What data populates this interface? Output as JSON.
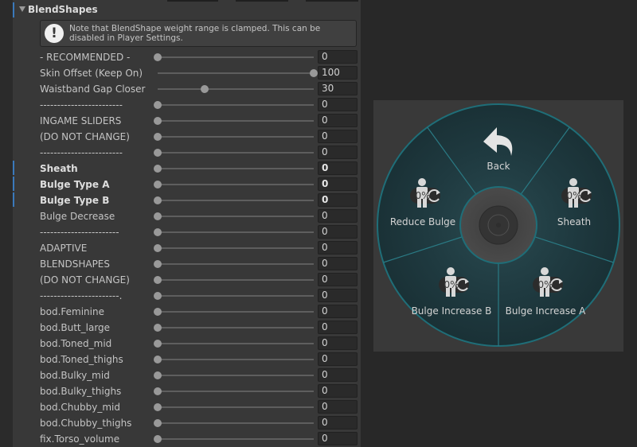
{
  "inspector": {
    "section_title": "BlendShapes",
    "help_text": "Note that BlendShape weight range is clamped. This can be disabled in Player Settings.",
    "help_icon": "exclamation-icon",
    "slider_max": 100,
    "rows": [
      {
        "label": "- RECOMMENDED -",
        "value": 0,
        "bold": false,
        "highlight": false
      },
      {
        "label": "Skin Offset (Keep On)",
        "value": 100,
        "bold": false,
        "highlight": false
      },
      {
        "label": "Waistband Gap Closer",
        "value": 30,
        "bold": false,
        "highlight": false
      },
      {
        "label": "------------------------",
        "value": 0,
        "bold": false,
        "highlight": false
      },
      {
        "label": "INGAME SLIDERS",
        "value": 0,
        "bold": false,
        "highlight": false
      },
      {
        "label": "(DO NOT CHANGE)",
        "value": 0,
        "bold": false,
        "highlight": false
      },
      {
        "label": "------------------------",
        "value": 0,
        "bold": false,
        "highlight": false
      },
      {
        "label": "Sheath",
        "value": 0,
        "bold": true,
        "highlight": true
      },
      {
        "label": "Bulge Type A",
        "value": 0,
        "bold": true,
        "highlight": true
      },
      {
        "label": "Bulge Type B",
        "value": 0,
        "bold": true,
        "highlight": true
      },
      {
        "label": "Bulge Decrease",
        "value": 0,
        "bold": false,
        "highlight": false
      },
      {
        "label": "-----------------------",
        "value": 0,
        "bold": false,
        "highlight": false
      },
      {
        "label": "ADAPTIVE",
        "value": 0,
        "bold": false,
        "highlight": false
      },
      {
        "label": "BLENDSHAPES",
        "value": 0,
        "bold": false,
        "highlight": false
      },
      {
        "label": "(DO NOT CHANGE)",
        "value": 0,
        "bold": false,
        "highlight": false
      },
      {
        "label": "-----------------------.",
        "value": 0,
        "bold": false,
        "highlight": false
      },
      {
        "label": "bod.Feminine",
        "value": 0,
        "bold": false,
        "highlight": false
      },
      {
        "label": "bod.Butt_large",
        "value": 0,
        "bold": false,
        "highlight": false
      },
      {
        "label": "bod.Toned_mid",
        "value": 0,
        "bold": false,
        "highlight": false
      },
      {
        "label": "bod.Toned_thighs",
        "value": 0,
        "bold": false,
        "highlight": false
      },
      {
        "label": "bod.Bulky_mid",
        "value": 0,
        "bold": false,
        "highlight": false
      },
      {
        "label": "bod.Bulky_thighs",
        "value": 0,
        "bold": false,
        "highlight": false
      },
      {
        "label": "bod.Chubby_mid",
        "value": 0,
        "bold": false,
        "highlight": false
      },
      {
        "label": "bod.Chubby_thighs",
        "value": 0,
        "bold": false,
        "highlight": false
      },
      {
        "label": "fix.Torso_volume",
        "value": 0,
        "bold": false,
        "highlight": false
      }
    ]
  },
  "radial_menu": {
    "colors": {
      "ring": "#1f6e78",
      "ring_fill": "#1d3a40",
      "center": "#4a4a4a",
      "panel": "#393939"
    },
    "items": [
      {
        "label": "Back",
        "icon": "back-arrow-icon",
        "percent": ""
      },
      {
        "label": "Sheath",
        "icon": "avatar-toggle-icon",
        "percent": "0%"
      },
      {
        "label": "Bulge Increase A",
        "icon": "avatar-toggle-icon",
        "percent": "0%"
      },
      {
        "label": "Bulge Increase B",
        "icon": "avatar-toggle-icon",
        "percent": "0%"
      },
      {
        "label": "Reduce Bulge",
        "icon": "avatar-toggle-icon",
        "percent": "0%"
      }
    ]
  }
}
